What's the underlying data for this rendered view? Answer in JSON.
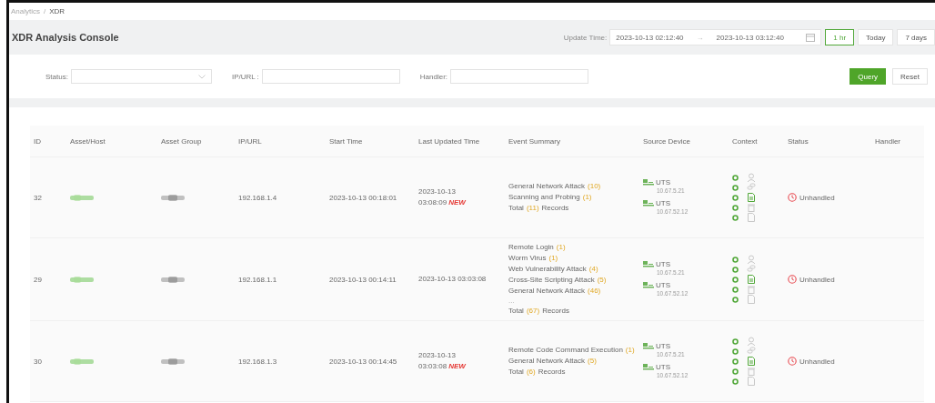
{
  "breadcrumb": [
    {
      "label": "Analytics",
      "current": false
    },
    {
      "label": "XDR",
      "current": true
    }
  ],
  "breadcrumb_separator": "/",
  "title": "XDR Analysis Console",
  "update_time": {
    "label": "Update Time:",
    "start": "2023-10-13 02:12:40",
    "separator": "→",
    "end": "2023-10-13 03:12:40"
  },
  "ranges": [
    {
      "label": "1 hr",
      "selected": true
    },
    {
      "label": "Today",
      "selected": false
    },
    {
      "label": "7 days",
      "selected": false
    }
  ],
  "filters": [
    {
      "label": "Status:",
      "kind": "select"
    },
    {
      "label": "IP/URL :",
      "kind": "text"
    },
    {
      "label": "Handler:",
      "kind": "text"
    }
  ],
  "buttons": [
    {
      "label": "Query",
      "kind": "primary"
    },
    {
      "label": "Reset",
      "kind": "default"
    }
  ],
  "table": {
    "columns": [
      "ID",
      "Asset/Host",
      "Asset Group",
      "IP/URL",
      "Start Time",
      "Last Updated Time",
      "Event Summary",
      "Source Device",
      "Context",
      "Status",
      "Handler"
    ],
    "rows": [
      {
        "id": "32",
        "ip": "192.168.1.4",
        "start": "2023-10-13 00:18:01",
        "updated": [
          "2023-10-13",
          "03:08:09"
        ],
        "new_label": "NEW",
        "events": [
          {
            "name": "General Network Attack",
            "count": "(10)"
          },
          {
            "name": "Scanning and Probing",
            "count": "(1)"
          }
        ],
        "total_prefix": "Total",
        "total": "(11)",
        "total_suffix": "Records",
        "devices": [
          {
            "name": "UTS",
            "ip": "10.67.5.21"
          },
          {
            "name": "UTS",
            "ip": "10.67.52.12"
          }
        ],
        "context": [
          {
            "kind": "user",
            "active": false
          },
          {
            "kind": "link",
            "active": false
          },
          {
            "kind": "file",
            "active": true
          },
          {
            "kind": "trash",
            "active": false
          },
          {
            "kind": "doc",
            "active": false
          }
        ],
        "status": "Unhandled"
      },
      {
        "id": "29",
        "ip": "192.168.1.1",
        "start": "2023-10-13 00:14:11",
        "updated": [
          "2023-10-13 03:03:08"
        ],
        "events": [
          {
            "name": "Remote Login",
            "count": "(1)"
          },
          {
            "name": "Worm Virus",
            "count": "(1)"
          },
          {
            "name": "Web Vulnerability Attack",
            "count": "(4)"
          },
          {
            "name": "Cross-Site Scripting Attack",
            "count": "(5)"
          },
          {
            "name": "General Network Attack",
            "count": "(46)"
          }
        ],
        "more": "...",
        "total_prefix": "Total",
        "total": "(67)",
        "total_suffix": "Records",
        "devices": [
          {
            "name": "UTS",
            "ip": "10.67.5.21"
          },
          {
            "name": "UTS",
            "ip": "10.67.52.12"
          }
        ],
        "context": [
          {
            "kind": "user",
            "active": false
          },
          {
            "kind": "link",
            "active": false
          },
          {
            "kind": "file",
            "active": true
          },
          {
            "kind": "trash",
            "active": false
          },
          {
            "kind": "doc",
            "active": false
          }
        ],
        "status": "Unhandled"
      },
      {
        "id": "30",
        "ip": "192.168.1.3",
        "start": "2023-10-13 00:14:45",
        "updated": [
          "2023-10-13",
          "03:03:08"
        ],
        "new_label": "NEW",
        "events": [
          {
            "name": "Remote Code Command Execution",
            "count": "(1)"
          },
          {
            "name": "General Network Attack",
            "count": "(5)"
          }
        ],
        "total_prefix": "Total",
        "total": "(6)",
        "total_suffix": "Records",
        "devices": [
          {
            "name": "UTS",
            "ip": "10.67.5.21"
          },
          {
            "name": "UTS",
            "ip": "10.67.52.12"
          }
        ],
        "context": [
          {
            "kind": "user",
            "active": false
          },
          {
            "kind": "link",
            "active": false
          },
          {
            "kind": "file",
            "active": true
          },
          {
            "kind": "trash",
            "active": false
          },
          {
            "kind": "doc",
            "active": false
          }
        ],
        "status": "Unhandled"
      }
    ]
  }
}
